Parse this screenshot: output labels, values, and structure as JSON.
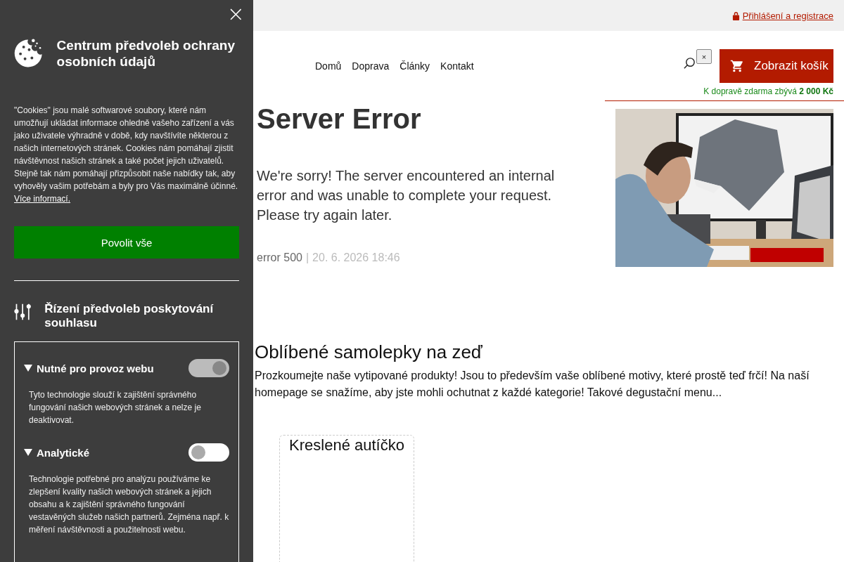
{
  "top_bar": {
    "login_link": "Přihlášení a registrace"
  },
  "nav": [
    {
      "label": "Domů"
    },
    {
      "label": "Doprava"
    },
    {
      "label": "Články"
    },
    {
      "label": "Kontakt"
    }
  ],
  "search_clear": "×",
  "cart": {
    "label": "Zobrazit košík",
    "free_shipping": "K dopravě zdarma zbývá **2 000 Kč**"
  },
  "error": {
    "title": "Server Error",
    "message": "We're sorry! The server encountered an internal error and was unable to complete your request. Please try again later.",
    "code": "error 500",
    "separator": "|",
    "timestamp": "20. 6. 2026 18:46"
  },
  "favorites": {
    "title": "Oblíbené samolepky na zeď",
    "text": "Prozkoumejte naše vytipované produkty! Jsou to především vaše oblíbené motivy, které prostě teď frčí! Na naší homepage se snažíme, aby jste mohli ochutnat z každé kategorie! Takové degustační menu...",
    "products": [
      {
        "name": "Kreslené autíčko"
      }
    ]
  },
  "cookie_panel": {
    "close": "×",
    "title": "Centrum předvoleb ochrany osobních údajů",
    "intro": "\"Cookies\" jsou malé softwarové soubory, které nám umožňují ukládat informace ohledně vašeho zařízení a vás jako uživatele výhradně v době, kdy navštívíte některou z našich internetových stránek. Cookies nám pomáhají zjistit návštěvnost našich stránek a také počet jejich uživatelů. Stejně tak nám pomáhají přizpůsobit naše nabídky tak, aby vyhověly vašim potřebám a byly pro Vás maximálně účinné.",
    "more_link": "Více informací.",
    "accept_all": "Povolit vše",
    "manage_title": "Řízení předvoleb poskytování souhlasu",
    "categories": [
      {
        "title": "Nutné pro provoz webu",
        "expanded": true,
        "on": true,
        "disabled": true,
        "description": "Tyto technologie slouží k zajištění správného fungování našich webových stránek a nelze je deaktivovat."
      },
      {
        "title": "Analytické",
        "expanded": true,
        "on": false,
        "disabled": false,
        "description": "Technologie potřebné pro analýzu používáme ke zlepšení kvality našich webových stránek a jejich obsahu a k zajištění správného fungování vestavěných služeb našich partnerů. Zejména např. k měření návštěvnosti a použitelnosti webu."
      }
    ]
  }
}
